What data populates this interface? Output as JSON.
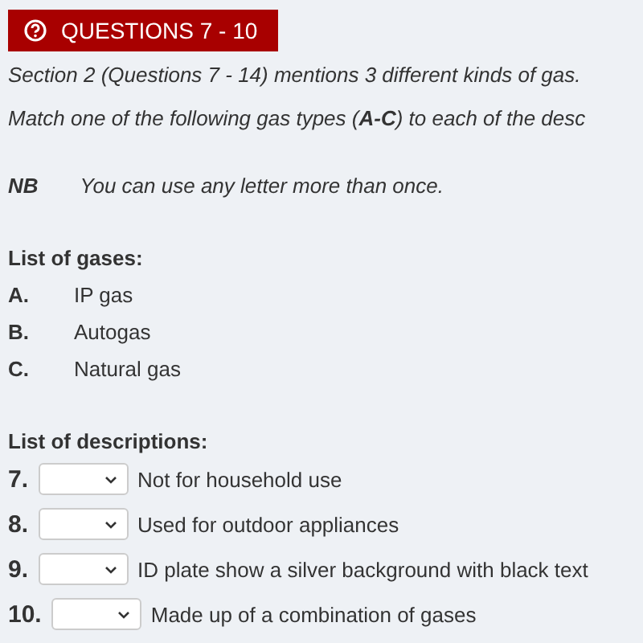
{
  "banner": {
    "title": "QUESTIONS 7 - 10"
  },
  "instructions": [
    "Section 2 (Questions 7 - 14) mentions 3 different kinds of gas.",
    "Match one of the following gas types (**A-C**) to each of the desc"
  ],
  "note": {
    "label": "NB",
    "text": "You can use any letter more than once."
  },
  "gases": {
    "heading": "List of gases:",
    "items": [
      {
        "letter": "A.",
        "name": "IP gas"
      },
      {
        "letter": "B.",
        "name": "Autogas"
      },
      {
        "letter": "C.",
        "name": "Natural gas"
      }
    ]
  },
  "descriptions": {
    "heading": "List of descriptions:",
    "items": [
      {
        "number": "7.",
        "text": "Not for household use"
      },
      {
        "number": "8.",
        "text": "Used for outdoor appliances"
      },
      {
        "number": "9.",
        "text": "ID plate show a silver background with black text"
      },
      {
        "number": "10.",
        "text": "Made up of a combination of gases"
      }
    ]
  }
}
